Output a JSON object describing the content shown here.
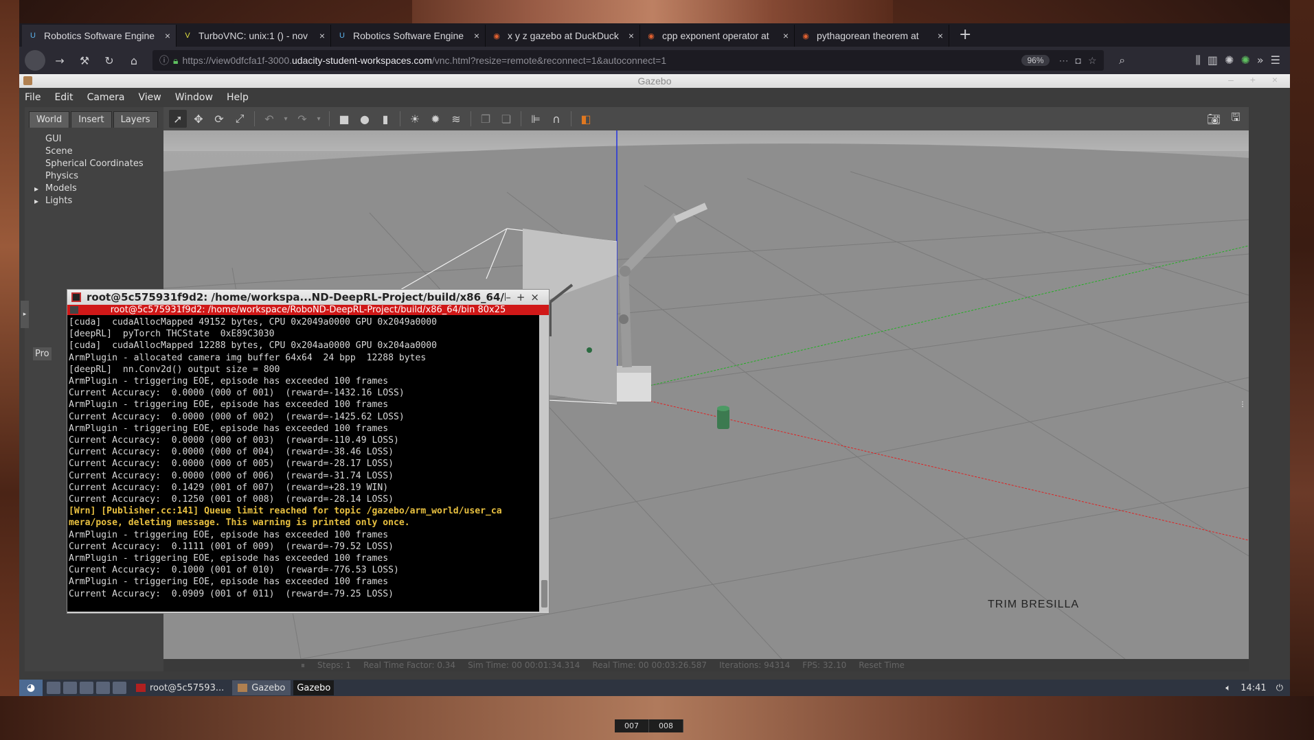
{
  "browser": {
    "tabs": [
      {
        "title": "Robotics Software Engine",
        "icon": "udacity-icon"
      },
      {
        "title": "TurboVNC: unix:1 () - nov",
        "icon": "vnc-icon"
      },
      {
        "title": "Robotics Software Engine",
        "icon": "udacity-icon"
      },
      {
        "title": "x y z gazebo at DuckDuck",
        "icon": "duckduckgo-icon"
      },
      {
        "title": "cpp exponent operator at",
        "icon": "duckduckgo-icon"
      },
      {
        "title": "pythagorean theorem at",
        "icon": "duckduckgo-icon"
      }
    ],
    "new_tab": "+",
    "url_prefix": "https://view0dfcfa1f-3000.",
    "url_host": "udacity-student-workspaces.com",
    "url_path": "/vnc.html?resize=remote&reconnect=1&autoconnect=1",
    "zoom": "96%"
  },
  "gazebo": {
    "title": "Gazebo",
    "menu": [
      "File",
      "Edit",
      "Camera",
      "View",
      "Window",
      "Help"
    ],
    "left_tabs": [
      "World",
      "Insert",
      "Layers"
    ],
    "tree": [
      {
        "label": "GUI",
        "expandable": false
      },
      {
        "label": "Scene",
        "expandable": false
      },
      {
        "label": "Spherical Coordinates",
        "expandable": false
      },
      {
        "label": "Physics",
        "expandable": false
      },
      {
        "label": "Models",
        "expandable": true
      },
      {
        "label": "Lights",
        "expandable": true
      }
    ],
    "property_label": "Pro",
    "overlay_text": "TRIM BRESILLA",
    "status": {
      "steps": "Steps: 1",
      "rtf": "Real Time Factor: 0.34",
      "sim_time": "Sim Time: 00 00:01:34.314",
      "real_time": "Real Time: 00 00:03:26.587",
      "iterations": "Iterations: 94314",
      "fps": "FPS: 32.10",
      "reset": "Reset Time"
    }
  },
  "terminal": {
    "title": "root@5c575931f9d2: /home/workspa...ND-DeepRL-Project/build/x86_64/bin",
    "subtitle": "root@5c575931f9d2: /home/workspace/RoboND-DeepRL-Project/build/x86_64/bin 80x25",
    "lines": [
      {
        "text": "[cuda]  cudaAllocMapped 49152 bytes, CPU 0x2049a0000 GPU 0x2049a0000",
        "warn": false
      },
      {
        "text": "[deepRL]  pyTorch THCState  0xE89C3030",
        "warn": false
      },
      {
        "text": "[cuda]  cudaAllocMapped 12288 bytes, CPU 0x204aa0000 GPU 0x204aa0000",
        "warn": false
      },
      {
        "text": "ArmPlugin - allocated camera img buffer 64x64  24 bpp  12288 bytes",
        "warn": false
      },
      {
        "text": "[deepRL]  nn.Conv2d() output size = 800",
        "warn": false
      },
      {
        "text": "ArmPlugin - triggering EOE, episode has exceeded 100 frames",
        "warn": false
      },
      {
        "text": "Current Accuracy:  0.0000 (000 of 001)  (reward=-1432.16 LOSS)",
        "warn": false
      },
      {
        "text": "ArmPlugin - triggering EOE, episode has exceeded 100 frames",
        "warn": false
      },
      {
        "text": "Current Accuracy:  0.0000 (000 of 002)  (reward=-1425.62 LOSS)",
        "warn": false
      },
      {
        "text": "ArmPlugin - triggering EOE, episode has exceeded 100 frames",
        "warn": false
      },
      {
        "text": "Current Accuracy:  0.0000 (000 of 003)  (reward=-110.49 LOSS)",
        "warn": false
      },
      {
        "text": "Current Accuracy:  0.0000 (000 of 004)  (reward=-38.46 LOSS)",
        "warn": false
      },
      {
        "text": "Current Accuracy:  0.0000 (000 of 005)  (reward=-28.17 LOSS)",
        "warn": false
      },
      {
        "text": "Current Accuracy:  0.0000 (000 of 006)  (reward=-31.74 LOSS)",
        "warn": false
      },
      {
        "text": "Current Accuracy:  0.1429 (001 of 007)  (reward=+28.19 WIN)",
        "warn": false
      },
      {
        "text": "Current Accuracy:  0.1250 (001 of 008)  (reward=-28.14 LOSS)",
        "warn": false
      },
      {
        "text": "[Wrn] [Publisher.cc:141] Queue limit reached for topic /gazebo/arm_world/user_ca",
        "warn": true
      },
      {
        "text": "mera/pose, deleting message. This warning is printed only once.",
        "warn": true
      },
      {
        "text": "ArmPlugin - triggering EOE, episode has exceeded 100 frames",
        "warn": false
      },
      {
        "text": "Current Accuracy:  0.1111 (001 of 009)  (reward=-79.52 LOSS)",
        "warn": false
      },
      {
        "text": "ArmPlugin - triggering EOE, episode has exceeded 100 frames",
        "warn": false
      },
      {
        "text": "Current Accuracy:  0.1000 (001 of 010)  (reward=-776.53 LOSS)",
        "warn": false
      },
      {
        "text": "ArmPlugin - triggering EOE, episode has exceeded 100 frames",
        "warn": false
      },
      {
        "text": "Current Accuracy:  0.0909 (001 of 011)  (reward=-79.25 LOSS)",
        "warn": false
      }
    ]
  },
  "taskbar": {
    "items": [
      {
        "label": "root@5c57593...",
        "icon": "terminal-icon",
        "active": false
      },
      {
        "label": "Gazebo",
        "icon": "gazebo-icon",
        "active": true
      }
    ],
    "tooltip": "Gazebo",
    "clock": "14:41"
  },
  "vnc_pages": [
    "007",
    "008"
  ],
  "colors": {
    "terminal_subtitle": "#d01818",
    "warning_text": "#e8c040",
    "x_axis": "#e02020",
    "y_axis": "#20c020",
    "z_axis": "#2020e0"
  }
}
